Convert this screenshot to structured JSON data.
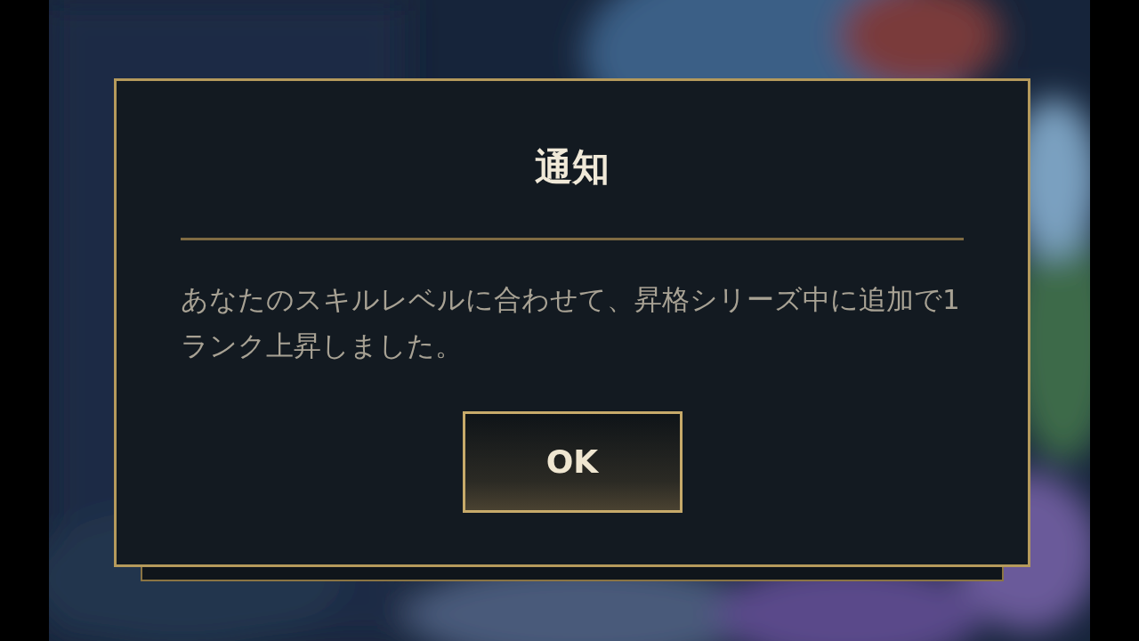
{
  "dialog": {
    "title": "通知",
    "message": "あなたのスキルレベルに合わせて、昇格シリーズ中に追加で1ランク上昇しました。",
    "button": "OK"
  }
}
